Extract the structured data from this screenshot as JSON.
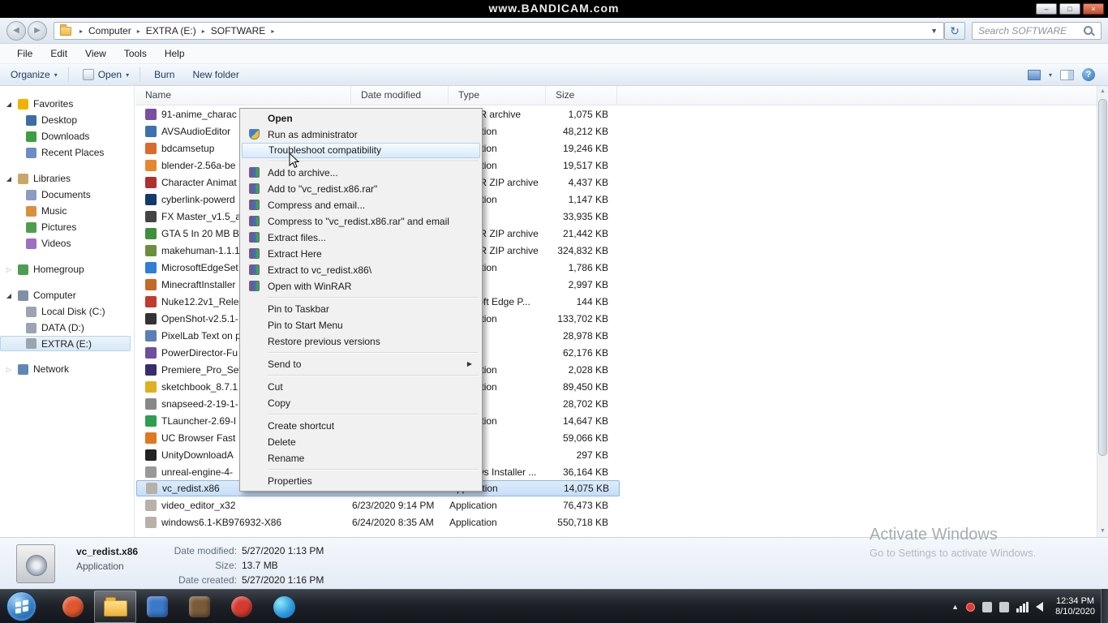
{
  "window": {
    "watermark": "www.BANDICAM.com",
    "controls": {
      "minimize": "–",
      "restore": "□",
      "close": "×"
    }
  },
  "address_bar": {
    "breadcrumb": [
      "Computer",
      "EXTRA (E:)",
      "SOFTWARE"
    ],
    "search_placeholder": "Search SOFTWARE"
  },
  "menu_bar": [
    "File",
    "Edit",
    "View",
    "Tools",
    "Help"
  ],
  "toolbar": {
    "organize": "Organize",
    "open": "Open",
    "burn": "Burn",
    "new_folder": "New folder"
  },
  "sidebar": {
    "groups": [
      {
        "label": "Favorites",
        "expanded": true,
        "icon_color": "#f0b400",
        "items": [
          {
            "label": "Desktop",
            "icon_color": "#3b6ea5"
          },
          {
            "label": "Downloads",
            "icon_color": "#3f9e3f"
          },
          {
            "label": "Recent Places",
            "icon_color": "#6b8cc7"
          }
        ]
      },
      {
        "label": "Libraries",
        "expanded": true,
        "icon_color": "#c9a76a",
        "items": [
          {
            "label": "Documents",
            "icon_color": "#8c9cc0"
          },
          {
            "label": "Music",
            "icon_color": "#d98f3f"
          },
          {
            "label": "Pictures",
            "icon_color": "#4f9e4f"
          },
          {
            "label": "Videos",
            "icon_color": "#9e6fc0"
          }
        ]
      },
      {
        "label": "Homegroup",
        "expanded": false,
        "icon_color": "#4f9e4f",
        "items": []
      },
      {
        "label": "Computer",
        "expanded": true,
        "icon_color": "#7f8fa5",
        "items": [
          {
            "label": "Local Disk (C:)",
            "icon_color": "#9aa5b0"
          },
          {
            "label": "DATA (D:)",
            "icon_color": "#9aa5b0"
          },
          {
            "label": "EXTRA (E:)",
            "icon_color": "#9aa5b0",
            "selected": true
          }
        ]
      },
      {
        "label": "Network",
        "expanded": false,
        "icon_color": "#5f87b5",
        "items": []
      }
    ]
  },
  "file_list": {
    "columns": [
      "Name",
      "Date modified",
      "Type",
      "Size"
    ],
    "rows": [
      {
        "name": "91-anime_charac",
        "date": "",
        "type": "WinRAR archive",
        "size": "1,075 KB",
        "icon_color": "#7a4fa0"
      },
      {
        "name": "AVSAudioEditor",
        "date": "",
        "type": "Application",
        "size": "48,212 KB",
        "icon_color": "#3f6fb0"
      },
      {
        "name": "bdcamsetup",
        "date": "",
        "type": "Application",
        "size": "19,246 KB",
        "icon_color": "#d96b2b"
      },
      {
        "name": "blender-2.56a-be",
        "date": "",
        "type": "Application",
        "size": "19,517 KB",
        "icon_color": "#e8862d"
      },
      {
        "name": "Character Animat",
        "date": "",
        "type": "WinRAR ZIP archive",
        "size": "4,437 KB",
        "icon_color": "#b03030"
      },
      {
        "name": "cyberlink-powerd",
        "date": "",
        "type": "Application",
        "size": "1,147 KB",
        "icon_color": "#123a6b"
      },
      {
        "name": "FX Master_v1.5_a",
        "date": "",
        "type": "",
        "size": "33,935 KB",
        "icon_color": "#444444"
      },
      {
        "name": "GTA 5 In 20 MB B",
        "date": "",
        "type": "WinRAR ZIP archive",
        "size": "21,442 KB",
        "icon_color": "#3f8f3f"
      },
      {
        "name": "makehuman-1.1.1",
        "date": "",
        "type": "WinRAR ZIP archive",
        "size": "324,832 KB",
        "icon_color": "#6b8e3f"
      },
      {
        "name": "MicrosoftEdgeSet",
        "date": "",
        "type": "Application",
        "size": "1,786 KB",
        "icon_color": "#2f7fd4"
      },
      {
        "name": "MinecraftInstaller",
        "date": "",
        "type": "",
        "size": "2,997 KB",
        "icon_color": "#c46a28"
      },
      {
        "name": "Nuke12.2v1_Relea",
        "date": "",
        "type": "Microsoft Edge P...",
        "size": "144 KB",
        "icon_color": "#c23b2e"
      },
      {
        "name": "OpenShot-v2.5.1-",
        "date": "",
        "type": "Application",
        "size": "133,702 KB",
        "icon_color": "#333333"
      },
      {
        "name": "PixelLab Text on p",
        "date": "",
        "type": "",
        "size": "28,978 KB",
        "icon_color": "#5a7fb5"
      },
      {
        "name": "PowerDirector-Fu",
        "date": "",
        "type": "",
        "size": "62,176 KB",
        "icon_color": "#6c4f9e"
      },
      {
        "name": "Premiere_Pro_Set",
        "date": "",
        "type": "Application",
        "size": "2,028 KB",
        "icon_color": "#3b2a6e"
      },
      {
        "name": "sketchbook_8.7.1",
        "date": "",
        "type": "Application",
        "size": "89,450 KB",
        "icon_color": "#e0b020"
      },
      {
        "name": "snapseed-2-19-1-",
        "date": "",
        "type": "",
        "size": "28,702 KB",
        "icon_color": "#888888"
      },
      {
        "name": "TLauncher-2.69-I",
        "date": "",
        "type": "Application",
        "size": "14,647 KB",
        "icon_color": "#2f9e4f"
      },
      {
        "name": "UC Browser Fast",
        "date": "",
        "type": "",
        "size": "59,066 KB",
        "icon_color": "#e07820"
      },
      {
        "name": "UnityDownloadA",
        "date": "",
        "type": "",
        "size": "297 KB",
        "icon_color": "#222222"
      },
      {
        "name": "unreal-engine-4-",
        "date": "",
        "type": "Windows Installer ...",
        "size": "36,164 KB",
        "icon_color": "#999999"
      },
      {
        "name": "vc_redist.x86",
        "date": "5/27/2020 1:13 PM",
        "type": "Application",
        "size": "14,075 KB",
        "icon_color": "#b7b1a9",
        "selected": true
      },
      {
        "name": "video_editor_x32",
        "date": "6/23/2020 9:14 PM",
        "type": "Application",
        "size": "76,473 KB",
        "icon_color": "#b7b1a9"
      },
      {
        "name": "windows6.1-KB976932-X86",
        "date": "6/24/2020 8:35 AM",
        "type": "Application",
        "size": "550,718 KB",
        "icon_color": "#b7b1a9"
      }
    ]
  },
  "context_menu": {
    "items": [
      {
        "label": "Open",
        "bold": true
      },
      {
        "label": "Run as administrator",
        "icon": "shield"
      },
      {
        "label": "Troubleshoot compatibility",
        "highlighted": true
      },
      {
        "separator": true
      },
      {
        "label": "Add to archive...",
        "icon": "winrar"
      },
      {
        "label": "Add to \"vc_redist.x86.rar\"",
        "icon": "winrar"
      },
      {
        "label": "Compress and email...",
        "icon": "winrar"
      },
      {
        "label": "Compress to \"vc_redist.x86.rar\" and email",
        "icon": "winrar"
      },
      {
        "label": "Extract files...",
        "icon": "winrar"
      },
      {
        "label": "Extract Here",
        "icon": "winrar"
      },
      {
        "label": "Extract to vc_redist.x86\\",
        "icon": "winrar"
      },
      {
        "label": "Open with WinRAR",
        "icon": "winrar"
      },
      {
        "separator": true
      },
      {
        "label": "Pin to Taskbar"
      },
      {
        "label": "Pin to Start Menu"
      },
      {
        "label": "Restore previous versions"
      },
      {
        "separator": true
      },
      {
        "label": "Send to",
        "submenu": true
      },
      {
        "separator": true
      },
      {
        "label": "Cut"
      },
      {
        "label": "Copy"
      },
      {
        "separator": true
      },
      {
        "label": "Create shortcut"
      },
      {
        "label": "Delete"
      },
      {
        "label": "Rename"
      },
      {
        "separator": true
      },
      {
        "label": "Properties"
      }
    ]
  },
  "details_pane": {
    "file_name": "vc_redist.x86",
    "file_type": "Application",
    "date_modified_label": "Date modified:",
    "date_modified": "5/27/2020 1:13 PM",
    "size_label": "Size:",
    "size": "13.7 MB",
    "date_created_label": "Date created:",
    "date_created": "5/27/2020 1:16 PM"
  },
  "activate_watermark": {
    "line1": "Activate Windows",
    "line2": "Go to Settings to activate Windows."
  },
  "taskbar": {
    "icons": [
      {
        "name": "app-1",
        "type": "circle",
        "color": "#e1552f"
      },
      {
        "name": "explorer",
        "type": "folder",
        "active": true
      },
      {
        "name": "app-2",
        "type": "square",
        "color": "#3a78c8"
      },
      {
        "name": "app-3",
        "type": "square",
        "color": "#7a5a38"
      },
      {
        "name": "app-4",
        "type": "circle",
        "color": "#d63a2f"
      },
      {
        "name": "edge",
        "type": "edge",
        "color": "#2e9ae0"
      }
    ],
    "clock_time": "12:34 PM",
    "clock_date": "8/10/2020"
  }
}
